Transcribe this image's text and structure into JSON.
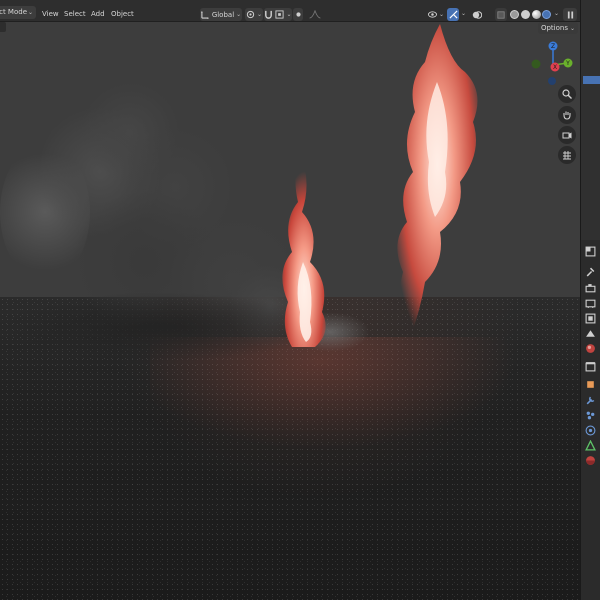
{
  "header": {
    "mode_label": "ect Mode",
    "menus": [
      "View",
      "Select",
      "Add",
      "Object"
    ],
    "transform_orientation": "Global"
  },
  "viewport": {
    "options_label": "Options",
    "gizmo_axes": [
      "Z",
      "Y",
      "X"
    ]
  },
  "icons": {
    "orientation": "transform-orientation-icon",
    "pivot": "pivot-point-icon",
    "snap": "snap-icon",
    "proportional": "proportional-editing-icon",
    "visibility": "object-visibility-icon",
    "gizmo": "gizmo-toggle-icon",
    "overlay": "overlay-icon",
    "xray": "xray-toggle-icon",
    "shading": [
      "wireframe-shading-icon",
      "solid-shading-icon",
      "material-preview-icon",
      "rendered-shading-icon"
    ],
    "zoom": "zoom-icon",
    "pan": "pan-hand-icon",
    "camera": "camera-view-icon",
    "ortho": "orthographic-grid-icon"
  },
  "colors": {
    "accent": "#4772b3",
    "axis_x": "#e0404f",
    "axis_y": "#6ab12c",
    "axis_z": "#3a7bd8",
    "fire": "#f07060"
  }
}
